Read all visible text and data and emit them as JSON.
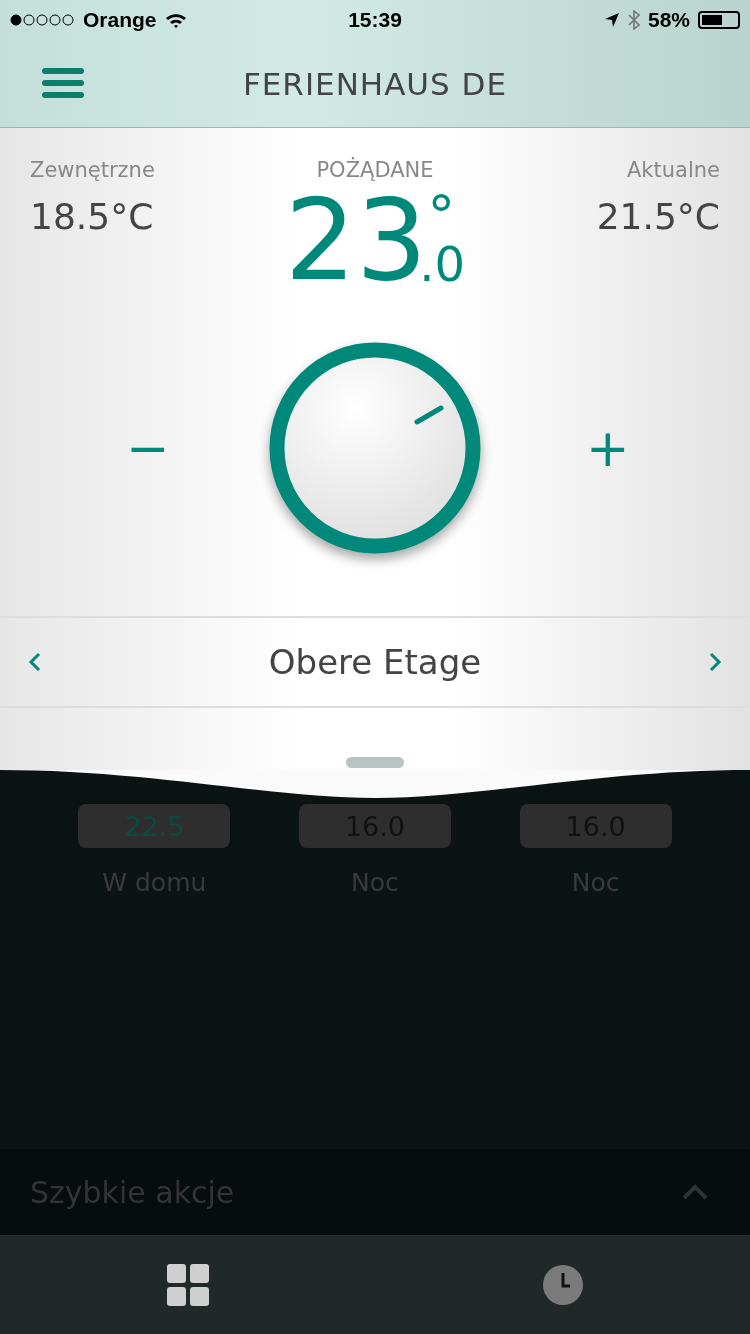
{
  "status_bar": {
    "carrier": "Orange",
    "time": "15:39",
    "battery_text": "58%"
  },
  "header": {
    "title": "FERIENHAUS DE"
  },
  "temperatures": {
    "outside": {
      "label": "Zewnętrzne",
      "value": "18.5°C"
    },
    "desired": {
      "label": "POŻĄDANE",
      "whole": "23",
      "degree": "°",
      "decimal": ".0"
    },
    "current": {
      "label": "Aktualne",
      "value": "21.5°C"
    }
  },
  "dial": {
    "minus": "−",
    "plus": "+"
  },
  "room": {
    "name": "Obere Etage"
  },
  "schedule": [
    {
      "value": "22.5",
      "label": "W domu",
      "active": true
    },
    {
      "value": "16.0",
      "label": "Noc",
      "active": false
    },
    {
      "value": "16.0",
      "label": "Noc",
      "active": false
    }
  ],
  "quick_actions": {
    "label": "Szybkie akcje"
  },
  "tabs": [
    {
      "kind": "grid",
      "selected": true
    },
    {
      "kind": "clock",
      "selected": false
    }
  ]
}
